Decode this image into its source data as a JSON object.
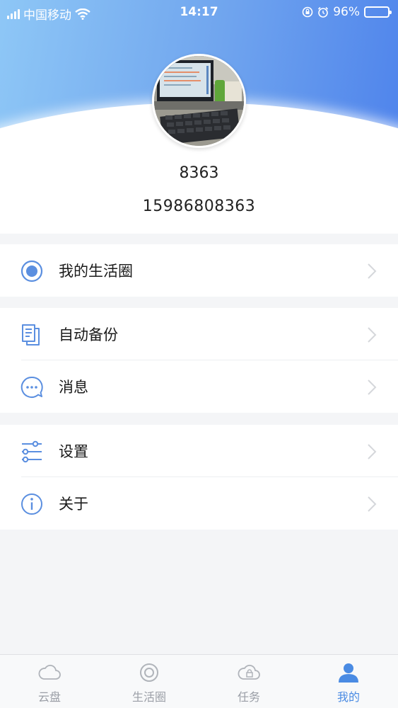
{
  "status_bar": {
    "carrier": "中国移动",
    "time": "14:17",
    "battery": "96%",
    "battery_level": 0.96
  },
  "profile": {
    "username": "8363",
    "phone": "15986808363"
  },
  "menu": {
    "life_circle": "我的生活圈",
    "auto_backup": "自动备份",
    "messages": "消息",
    "settings": "设置",
    "about": "关于"
  },
  "tabs": [
    {
      "label": "云盘",
      "icon": "cloud-icon",
      "active": false
    },
    {
      "label": "生活圈",
      "icon": "circle-icon",
      "active": false
    },
    {
      "label": "任务",
      "icon": "task-cloud-icon",
      "active": false
    },
    {
      "label": "我的",
      "icon": "person-icon",
      "active": true
    }
  ],
  "colors": {
    "accent": "#4a8be3",
    "header_gradient_start": "#8ec7f6",
    "header_gradient_end": "#4f84ec",
    "inactive": "#9a9ea6"
  }
}
